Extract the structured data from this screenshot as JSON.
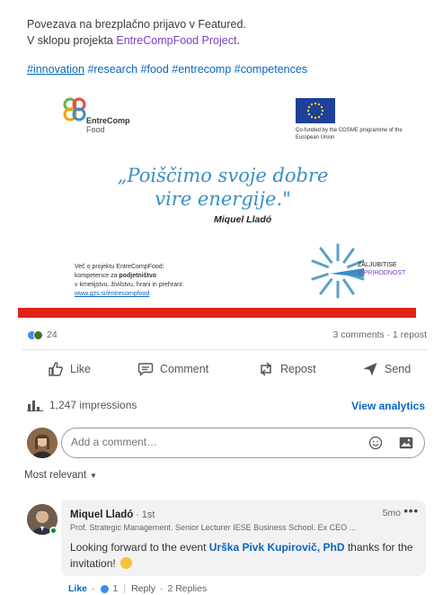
{
  "post": {
    "intro_line1": "Povezava na brezplačno prijavo v Featured.",
    "intro_line2_prefix": "V sklopu projekta ",
    "intro_line2_org": "EntreCompFood Project",
    "intro_line2_suffix": ".",
    "hashtags": [
      "#innovation",
      "#research",
      "#food",
      "#entrecomp",
      "#competences"
    ]
  },
  "image": {
    "logo_word1": "EntreComp",
    "logo_word2": "Food",
    "eu_text": "Co-funded by the COSME programme of the European Union",
    "quote": "„Poiščimo svoje dobre vire energije.\"",
    "quote_author": "Miquel Lladó",
    "more_info_line1": "Več o projektu EntreCompFood:",
    "more_info_line2_prefix": "kompetence za ",
    "more_info_line2_bold": "podjetništvo",
    "more_info_line3": "v kmetijstvu, živilstvu, hrani in prehrani:",
    "more_info_link": "www.gzs.si/entrecompfood",
    "badge_line1": "ZALJUBITISE",
    "badge_line2": "V PRIHODNOST",
    "accent_red": "#e2231a"
  },
  "social": {
    "reaction_count": "24",
    "comments_reposts": "3 comments · 1 repost"
  },
  "actions": {
    "like": "Like",
    "comment": "Comment",
    "repost": "Repost",
    "send": "Send"
  },
  "impressions": {
    "text": "1,247 impressions",
    "analytics": "View analytics"
  },
  "composer": {
    "placeholder": "Add a comment…"
  },
  "sort": {
    "label": "Most relevant"
  },
  "comment": {
    "author": "Miquel Lladó",
    "degree": "· 1st",
    "time": "5mo",
    "more": "•••",
    "headline": "Prof. Strategic Management. Senior Lecturer IESE Business School. Ex CEO ...",
    "text_prefix": "Looking forward to the event ",
    "mention": "Urška Pivk Kupirovič, PhD",
    "text_suffix": " thanks for the invitation!",
    "like": "Like",
    "like_count": "1",
    "reply": "Reply",
    "replies": "2 Replies"
  }
}
